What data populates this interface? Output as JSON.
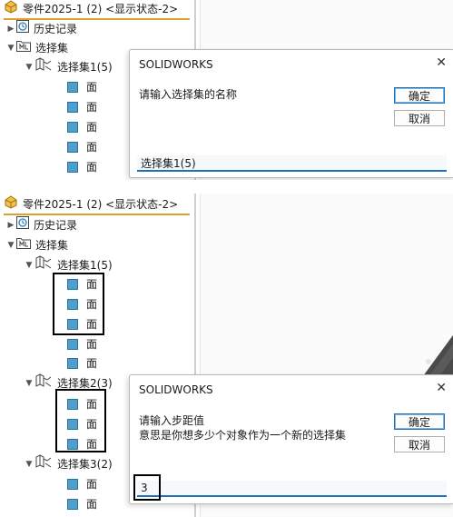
{
  "top": {
    "tree": {
      "part_title": "零件2025-1 (2) <显示状态-2>",
      "history": "历史记录",
      "selection_sets": "选择集",
      "set1": "选择集1(5)",
      "faces": [
        "面",
        "面",
        "面",
        "面",
        "面"
      ]
    },
    "dialog": {
      "title": "SOLIDWORKS",
      "message": "请输入选择集的名称",
      "ok": "确定",
      "cancel": "取消",
      "input_value": "选择集1(5)"
    }
  },
  "bottom": {
    "tree": {
      "part_title": "零件2025-1 (2) <显示状态-2>",
      "history": "历史记录",
      "selection_sets": "选择集",
      "set1": "选择集1(5)",
      "set1_faces": [
        "面",
        "面",
        "面",
        "面",
        "面"
      ],
      "set2": "选择集2(3)",
      "set2_faces": [
        "面",
        "面",
        "面"
      ],
      "set3": "选择集3(2)",
      "set3_faces": [
        "面",
        "面"
      ]
    },
    "dialog": {
      "title": "SOLIDWORKS",
      "message_line1": "请输入步距值",
      "message_line2": "意思是你想多少个对象作为一个新的选择集",
      "ok": "确定",
      "cancel": "取消",
      "input_value": "3"
    }
  },
  "icons": {
    "close": "close-icon",
    "caret_right": "caret-right-icon",
    "caret_down": "caret-down-icon",
    "part": "part-icon",
    "history": "history-icon",
    "selection_folder": "selection-folder-icon",
    "selection_set": "selection-set-icon",
    "face": "face-icon"
  },
  "colors": {
    "accent": "#1f6fb5",
    "face": "#4f9fcc",
    "tree_underline": "#e0a030"
  }
}
